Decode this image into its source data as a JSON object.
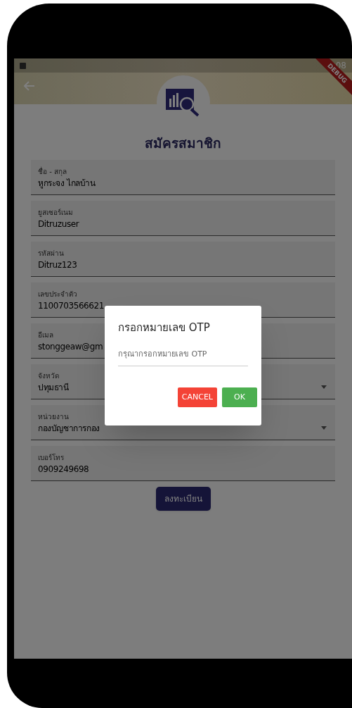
{
  "status_bar": {
    "time": ":08"
  },
  "debug_banner": {
    "label": "DEBUG"
  },
  "page": {
    "title": "สมัครสมาชิก",
    "fields": [
      {
        "kind": "text",
        "label": "ชื่อ - สกุล",
        "value": "หูกระจง ไกลบ้าน"
      },
      {
        "kind": "text",
        "label": "ยูสเซอร์เนม",
        "value": "Ditruzuser"
      },
      {
        "kind": "text",
        "label": "รหัสผ่าน",
        "value": "Ditruz123"
      },
      {
        "kind": "text",
        "label": "เลขประจำตัว",
        "value": "1100703566621"
      },
      {
        "kind": "text",
        "label": "อีเมล",
        "value": "stonggeaw@gm"
      },
      {
        "kind": "dropdown",
        "label": "จังหวัด",
        "value": "ปทุมธานี"
      },
      {
        "kind": "dropdown",
        "label": "หน่วยงาน",
        "value": "กองบัญชาการกอง"
      },
      {
        "kind": "text",
        "label": "เบอร์โทร",
        "value": "0909249698"
      }
    ],
    "submit_button": "ลงทะเบียน"
  },
  "dialog": {
    "title": "กรอกหมายเลข OTP",
    "otp_field": {
      "placeholder": "กรุณากรอกหมายเลข OTP"
    },
    "buttons": [
      {
        "kind": "cancel",
        "label": "CANCEL"
      },
      {
        "kind": "confirm",
        "label": "OK"
      }
    ]
  }
}
